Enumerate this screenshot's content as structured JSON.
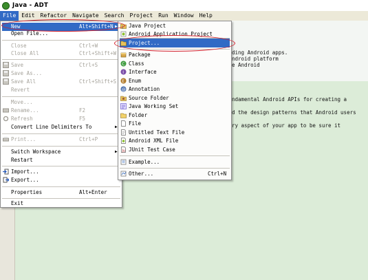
{
  "window": {
    "title": "Java - ADT"
  },
  "menubar": [
    "File",
    "Edit",
    "Refactor",
    "Navigate",
    "Search",
    "Project",
    "Run",
    "Window",
    "Help"
  ],
  "file_menu": {
    "new": {
      "label": "New",
      "accel": "Alt+Shift+N"
    },
    "items": [
      {
        "label": "Open File...",
        "accel": ""
      },
      {
        "label": "Close",
        "accel": "Ctrl+W"
      },
      {
        "label": "Close All",
        "accel": "Ctrl+Shift+W"
      },
      {
        "label": "Save",
        "accel": "Ctrl+S"
      },
      {
        "label": "Save As...",
        "accel": ""
      },
      {
        "label": "Save All",
        "accel": "Ctrl+Shift+S"
      },
      {
        "label": "Revert",
        "accel": ""
      },
      {
        "label": "Move...",
        "accel": ""
      },
      {
        "label": "Rename...",
        "accel": "F2"
      },
      {
        "label": "Refresh",
        "accel": "F5"
      },
      {
        "label": "Convert Line Delimiters To",
        "accel": ""
      },
      {
        "label": "Print...",
        "accel": "Ctrl+P"
      },
      {
        "label": "Switch Workspace",
        "accel": ""
      },
      {
        "label": "Restart",
        "accel": ""
      },
      {
        "label": "Import...",
        "accel": ""
      },
      {
        "label": "Export...",
        "accel": ""
      },
      {
        "label": "Properties",
        "accel": "Alt+Enter"
      },
      {
        "label": "Exit",
        "accel": ""
      }
    ]
  },
  "new_menu": {
    "items": [
      {
        "label": "Java Project",
        "icon": "java-project-icon"
      },
      {
        "label": "Android Application Project",
        "icon": "android-app-icon"
      },
      {
        "label": "Project...",
        "icon": "project-icon"
      },
      {
        "label": "Package",
        "icon": "package-icon"
      },
      {
        "label": "Class",
        "icon": "class-icon"
      },
      {
        "label": "Interface",
        "icon": "interface-icon"
      },
      {
        "label": "Enum",
        "icon": "enum-icon"
      },
      {
        "label": "Annotation",
        "icon": "annotation-icon"
      },
      {
        "label": "Source Folder",
        "icon": "source-folder-icon"
      },
      {
        "label": "Java Working Set",
        "icon": "working-set-icon"
      },
      {
        "label": "Folder",
        "icon": "folder-icon"
      },
      {
        "label": "File",
        "icon": "file-icon"
      },
      {
        "label": "Untitled Text File",
        "icon": "text-file-icon"
      },
      {
        "label": "Android XML File",
        "icon": "xml-file-icon"
      },
      {
        "label": "JUnit Test Case",
        "icon": "junit-icon"
      },
      {
        "label": "Example...",
        "icon": "example-icon"
      },
      {
        "label": "Other...",
        "icon": "other-icon"
      }
    ],
    "other_accel": "Ctrl+N"
  },
  "welcome_lines": [
    "ding Android apps.",
    "ndroid platform",
    "e Android",
    "ndamental Android APIs for creating a",
    "d the design patterns that Android users",
    "ry aspect of your app to be sure it"
  ],
  "colors": {
    "highlight": "#316ac5",
    "annotation_oval": "#d21e2a",
    "welcome_green": "#dcecd8"
  }
}
